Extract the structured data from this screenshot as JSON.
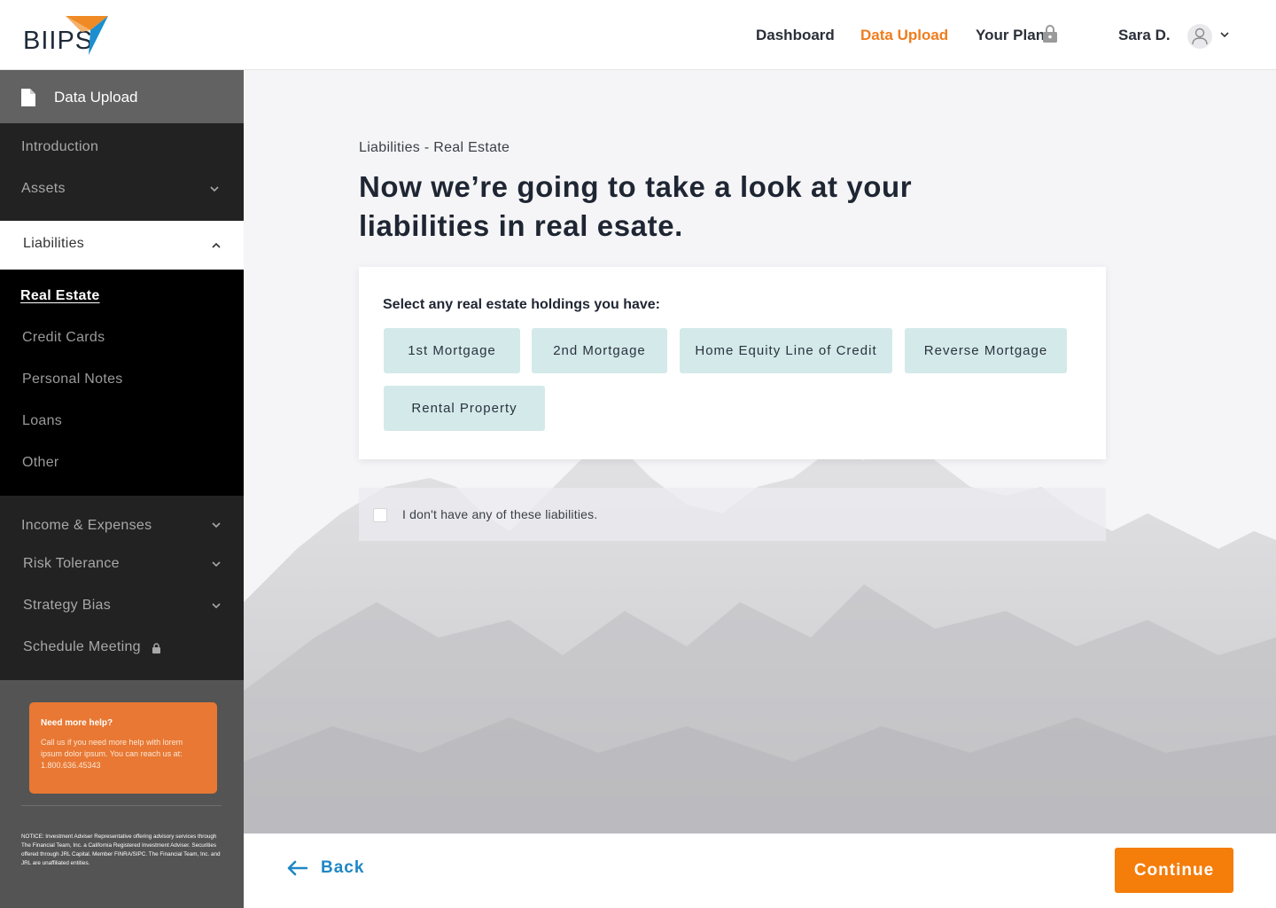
{
  "header": {
    "logo_text": "BIIPS",
    "nav": [
      {
        "label": "Dashboard"
      },
      {
        "label": "Data Upload"
      },
      {
        "label": "Your Plan"
      }
    ],
    "user_name": "Sara D."
  },
  "colors": {
    "accent": "#ef7d1e",
    "link": "#1f87c4",
    "chip": "#d4e9e9",
    "help_card": "#e87833"
  },
  "sidebar": {
    "title": "Data Upload",
    "items_top": [
      {
        "label": "Introduction"
      },
      {
        "label": "Assets"
      }
    ],
    "open_section": "Liabilities",
    "sub_items": [
      {
        "label": "Real Estate"
      },
      {
        "label": "Credit Cards"
      },
      {
        "label": "Personal Notes"
      },
      {
        "label": "Loans"
      },
      {
        "label": "Other"
      }
    ],
    "items_bottom": [
      {
        "label": "Income & Expenses"
      },
      {
        "label": "Risk Tolerance"
      },
      {
        "label": "Strategy Bias"
      },
      {
        "label": "Schedule Meeting"
      }
    ],
    "help": {
      "title": "Need more help?",
      "body": "Call us if you need more help with lorem ipsum dolor ipsum. You can reach us at: 1.800.636.45343"
    },
    "notice": "NOTICE: Investment Adviser Representative offering advisory services through The Financial Team, Inc. a California Registered Investment Adviser. Securities offered through JRL Capital. Member FINRA/SIPC. The Financial Team, Inc. and JRL are unaffiliated entities."
  },
  "main": {
    "breadcrumb": "Liabilities - Real Estate",
    "headline": "Now we’re going to take a look at your liabilities in real esate.",
    "card_label": "Select any real estate holdings  you have:",
    "options": [
      {
        "label": "1st Mortgage"
      },
      {
        "label": "2nd Mortgage"
      },
      {
        "label": "Home Equity Line of Credit"
      },
      {
        "label": "Reverse Mortgage"
      },
      {
        "label": "Rental Property"
      }
    ],
    "none_label": "I don't have any of these liabilities."
  },
  "footer": {
    "back_label": "Back",
    "continue_label": "Continue"
  }
}
